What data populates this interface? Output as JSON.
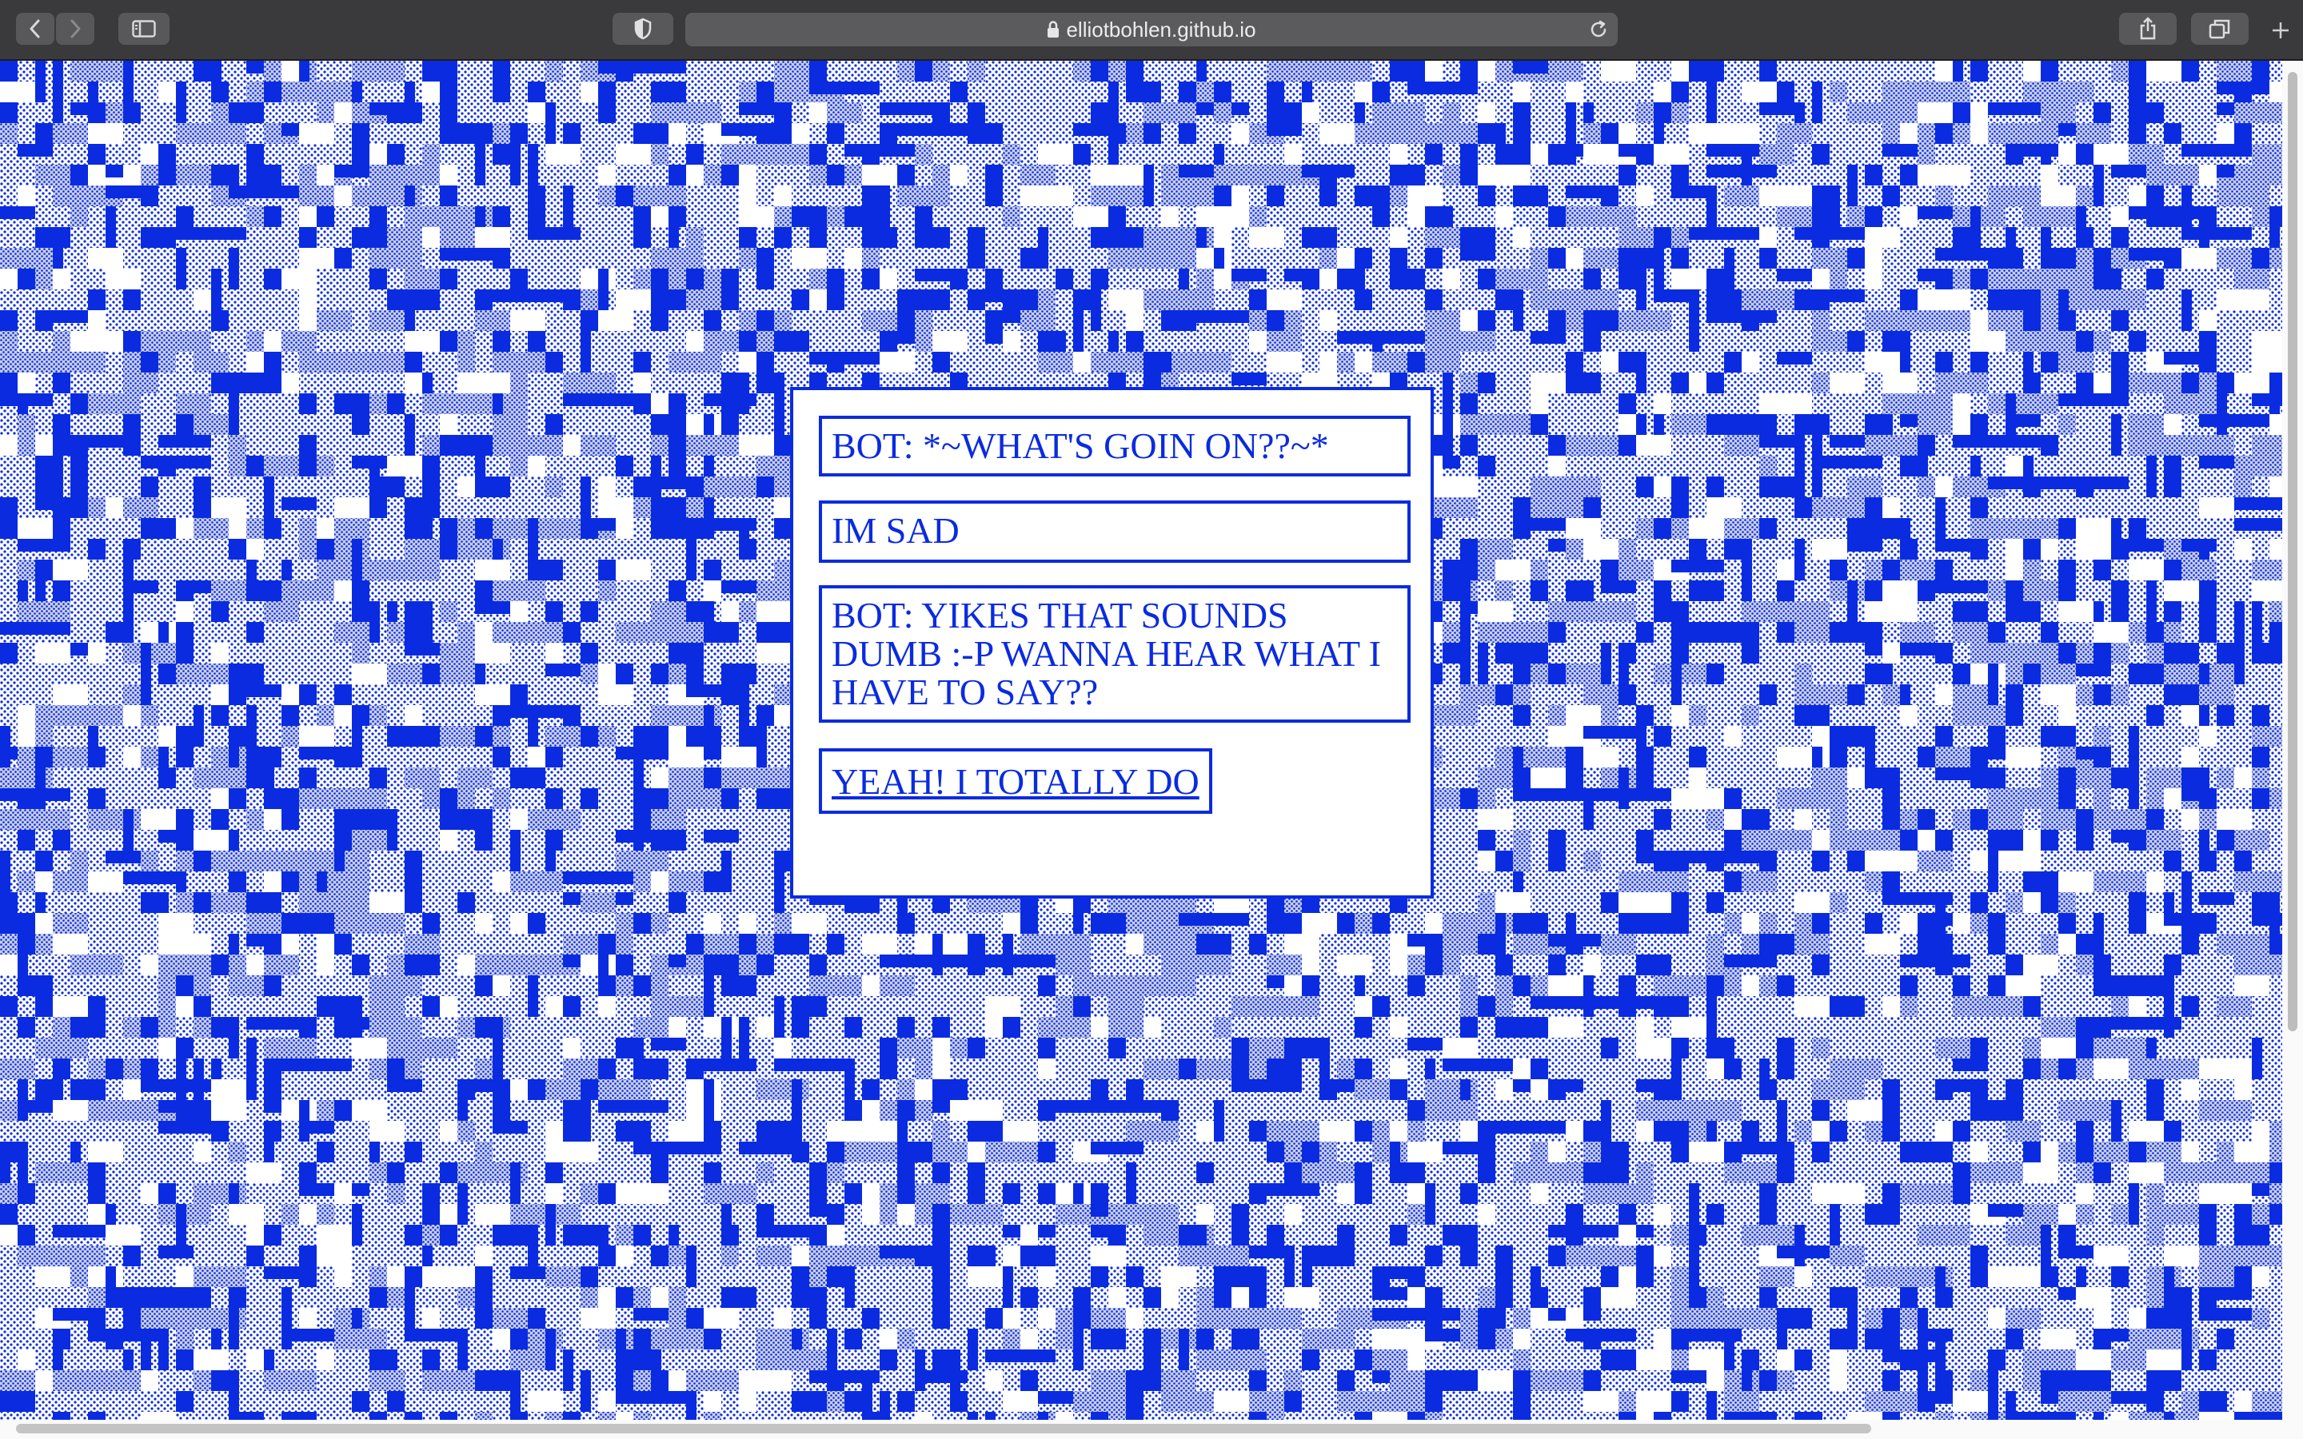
{
  "browser": {
    "url": "elliotbohlen.github.io",
    "accent_page_color": "#0a2be0",
    "icons": [
      "back-icon",
      "forward-icon",
      "sidebar-icon",
      "privacy-shield-icon",
      "lock-icon",
      "reload-icon",
      "share-icon",
      "tabs-icon",
      "new-tab-icon"
    ]
  },
  "chat": {
    "messages": [
      "BOT: *~WHAT'S GOIN ON??~*",
      "IM SAD",
      "BOT: YIKES THAT SOUNDS DUMB :-P WANNA HEAR WHAT I HAVE TO SAY??"
    ],
    "reply_label": "YEAH! I TOTALLY DO"
  },
  "background": {
    "pattern": "blue pixel blocks with dotted halftone texture",
    "color": "#0a2be0"
  }
}
